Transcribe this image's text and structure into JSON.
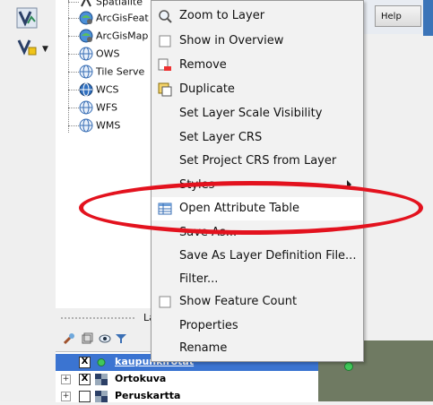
{
  "top": {
    "help_label": "Help"
  },
  "browser": {
    "items": [
      {
        "label": "Spatialite",
        "icon": "spatialite-icon"
      },
      {
        "label": "ArcGisFeat",
        "icon": "arcgis-feature-icon"
      },
      {
        "label": "ArcGisMap",
        "icon": "arcgis-map-icon"
      },
      {
        "label": "OWS",
        "icon": "ows-icon"
      },
      {
        "label": "Tile Serve",
        "icon": "tile-server-icon"
      },
      {
        "label": "WCS",
        "icon": "wcs-icon"
      },
      {
        "label": "WFS",
        "icon": "wfs-icon"
      },
      {
        "label": "WMS",
        "icon": "wms-icon"
      }
    ]
  },
  "layers": {
    "header_label": "La",
    "rows": [
      {
        "name": "kaupunkirotat",
        "checked": "X",
        "expander": ""
      },
      {
        "name": "Ortokuva",
        "checked": "X",
        "expander": "+"
      },
      {
        "name": "Peruskartta",
        "checked": "",
        "expander": "+"
      }
    ]
  },
  "menu": {
    "items": [
      {
        "label": "Zoom to Layer",
        "icon": "zoom-icon"
      },
      {
        "label": "Show in Overview",
        "icon": "checkbox-icon"
      },
      {
        "label": "Remove",
        "icon": "remove-layer-icon"
      },
      {
        "label": "Duplicate",
        "icon": "duplicate-icon"
      },
      {
        "label": "Set Layer Scale Visibility",
        "icon": ""
      },
      {
        "label": "Set Layer CRS",
        "icon": ""
      },
      {
        "label": "Set Project CRS from Layer",
        "icon": ""
      },
      {
        "label": "Styles",
        "icon": "",
        "submenu": true
      },
      {
        "label": "Open Attribute Table",
        "icon": "table-icon"
      },
      {
        "label": "Save As...",
        "icon": ""
      },
      {
        "label": "Save As Layer Definition File...",
        "icon": ""
      },
      {
        "label": "Filter...",
        "icon": ""
      },
      {
        "label": "Show Feature Count",
        "icon": "checkbox-icon"
      },
      {
        "label": "Properties",
        "icon": ""
      },
      {
        "label": "Rename",
        "icon": ""
      }
    ]
  },
  "colors": {
    "selection": "#3b74d1",
    "highlight_ellipse": "#e3121e",
    "menu_bg": "#f2f2f2"
  }
}
